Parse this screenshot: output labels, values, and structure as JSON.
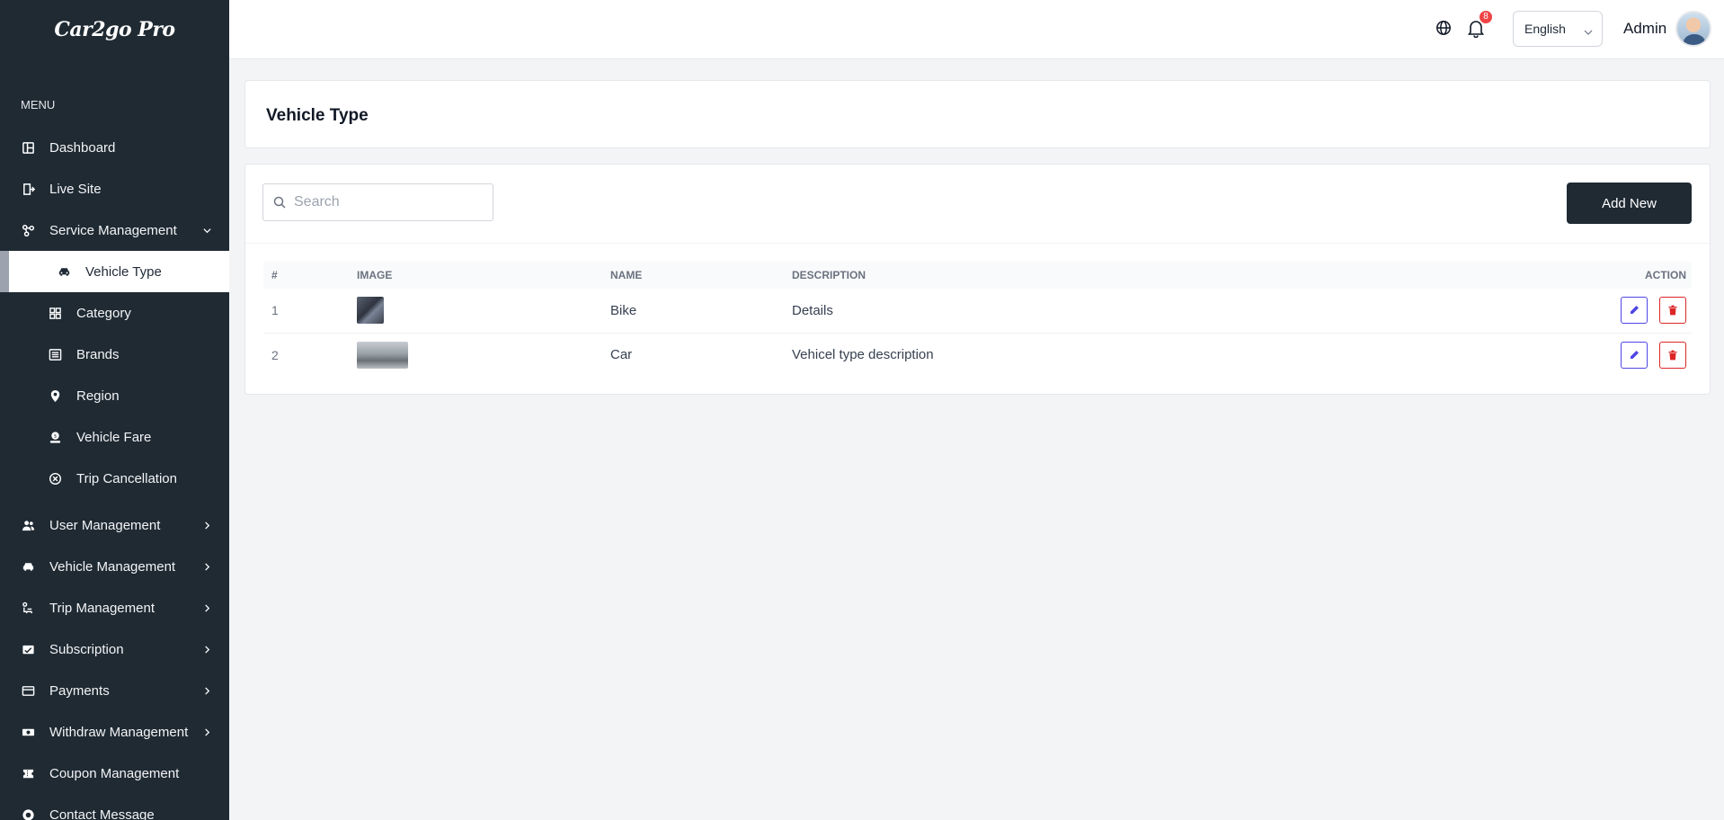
{
  "app": {
    "logo": "Car2go Pro"
  },
  "sidebar": {
    "menu_title": "MENU",
    "items": [
      {
        "label": "Dashboard",
        "icon": "dashboard-icon"
      },
      {
        "label": "Live Site",
        "icon": "live-site-icon"
      },
      {
        "label": "Service Management",
        "icon": "service-icon",
        "expanded": true
      },
      {
        "label": "User Management",
        "icon": "users-icon"
      },
      {
        "label": "Vehicle Management",
        "icon": "car-icon"
      },
      {
        "label": "Trip Management",
        "icon": "trip-icon"
      },
      {
        "label": "Subscription",
        "icon": "subscription-icon"
      },
      {
        "label": "Payments",
        "icon": "card-icon"
      },
      {
        "label": "Withdraw Management",
        "icon": "money-icon"
      },
      {
        "label": "Coupon Management",
        "icon": "coupon-icon"
      },
      {
        "label": "Contact Message",
        "icon": "contact-icon"
      }
    ],
    "service_sub": [
      {
        "label": "Vehicle Type",
        "icon": "car-icon",
        "active": true
      },
      {
        "label": "Category",
        "icon": "grid-icon"
      },
      {
        "label": "Brands",
        "icon": "list-icon"
      },
      {
        "label": "Region",
        "icon": "pin-icon"
      },
      {
        "label": "Vehicle Fare",
        "icon": "fare-icon"
      },
      {
        "label": "Trip Cancellation",
        "icon": "cancel-icon"
      }
    ]
  },
  "topbar": {
    "notification_count": "8",
    "language": "English",
    "user_name": "Admin"
  },
  "page": {
    "title": "Vehicle Type",
    "search_placeholder": "Search",
    "add_button": "Add New"
  },
  "table": {
    "columns": [
      "#",
      "IMAGE",
      "NAME",
      "DESCRIPTION",
      "ACTION"
    ],
    "rows": [
      {
        "num": "1",
        "name": "Bike",
        "description": "Details",
        "image": "bike"
      },
      {
        "num": "2",
        "name": "Car",
        "description": "Vehicel type description",
        "image": "car"
      }
    ]
  },
  "colors": {
    "sidebar_bg": "#1f2a33",
    "primary_button": "#1f2a33",
    "edit_accent": "#4f46e5",
    "delete_accent": "#dc2626",
    "badge": "#ef4444"
  }
}
